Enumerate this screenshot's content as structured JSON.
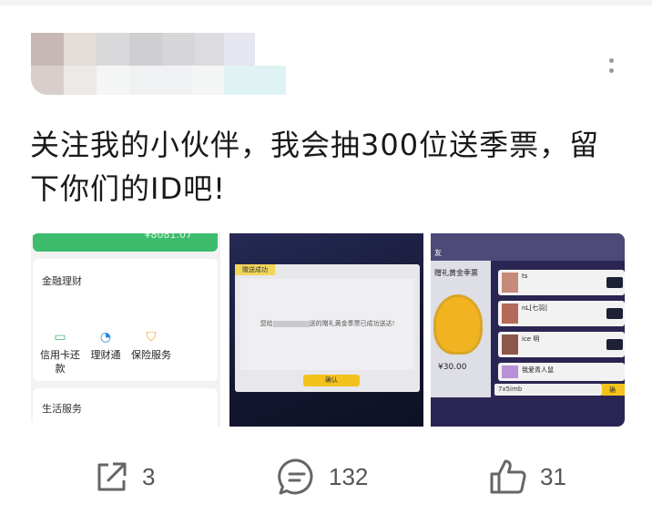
{
  "post": {
    "text": "关注我的小伙伴，我会抽300位送季票，留下你们的ID吧!"
  },
  "images": {
    "bank_app": {
      "balance": "¥8081.07",
      "section_finance": "金融理财",
      "items": [
        "信用卡还款",
        "理财通",
        "保险服务"
      ],
      "section_life": "生活服务"
    },
    "gift_dialog": {
      "title": "赠送成功",
      "message_prefix": "您给",
      "message_suffix": "送的赠礼黄金季票已成功送达!",
      "confirm": "确认"
    },
    "friends_list": {
      "tab": "友",
      "gift_label": "赠礼黄金季票",
      "price": "¥30.00",
      "rows": [
        "ts",
        "nL[七羽]",
        "ice 明",
        "我爱青人鼠"
      ],
      "input_value": "7x5imb",
      "confirm": "确"
    }
  },
  "actions": {
    "share_count": "3",
    "comment_count": "132",
    "like_count": "31"
  },
  "colors": {
    "green": "#3cbc6c",
    "yellow": "#f4c21c",
    "icon_gray": "#666666"
  }
}
